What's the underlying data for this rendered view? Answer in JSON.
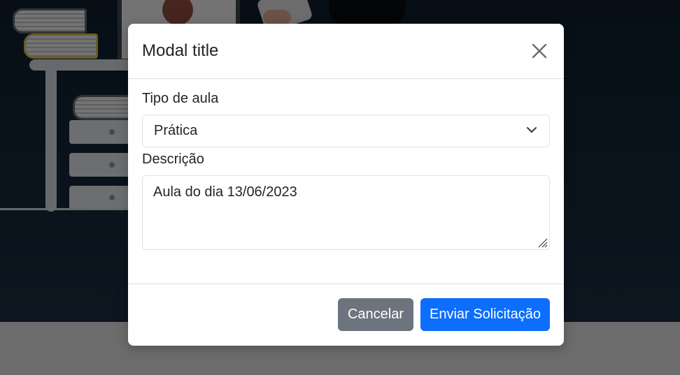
{
  "modal": {
    "title": "Modal title",
    "fields": {
      "type_label": "Tipo de aula",
      "type_value": "Prática",
      "description_label": "Descrição",
      "description_value": "Aula do dia 13/06/2023"
    },
    "buttons": {
      "cancel": "Cancelar",
      "submit": "Enviar Solicitação"
    }
  },
  "colors": {
    "primary": "#0d6efd",
    "secondary": "#6c757d",
    "backdrop": "rgba(0,0,0,0.5)"
  },
  "icons": [
    "close-icon",
    "chevron-down-icon",
    "resize-grip-icon"
  ]
}
